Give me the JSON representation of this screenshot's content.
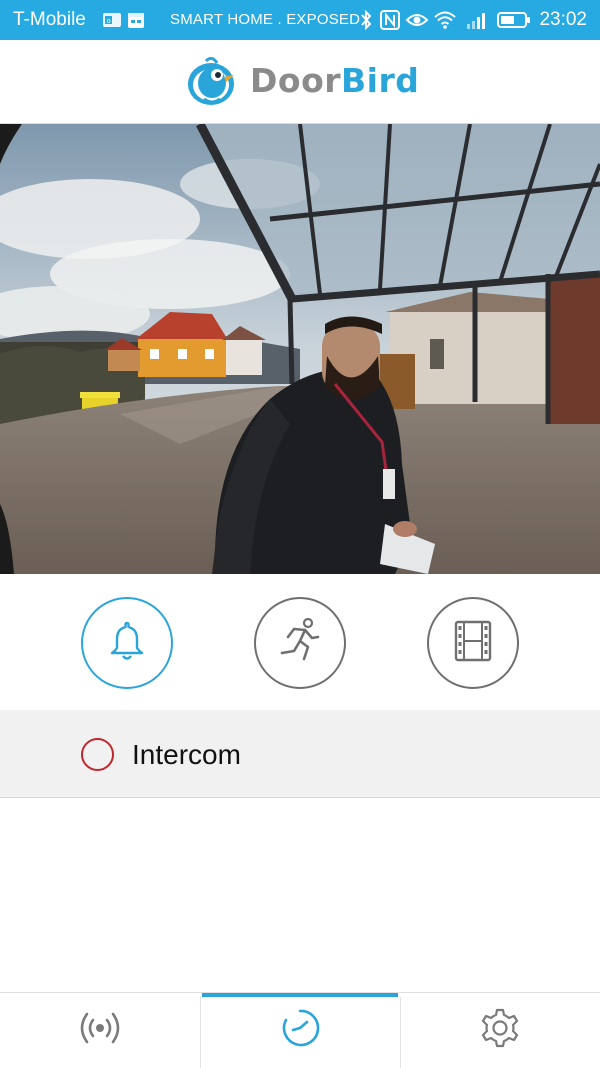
{
  "status_bar": {
    "carrier": "T-Mobile",
    "banner": "SMART HOME . EXPOSED",
    "time": "23:02",
    "icons": [
      "outlook-icon",
      "calendar-icon",
      "bluetooth-icon",
      "nfc-icon",
      "eye-icon",
      "wifi-icon",
      "signal-icon",
      "battery-icon"
    ]
  },
  "header": {
    "logo_word_1": "Door",
    "logo_word_2": "Bird"
  },
  "actions": [
    {
      "name": "doorbell",
      "icon": "bell-icon",
      "active": true
    },
    {
      "name": "motion",
      "icon": "running-person-icon",
      "active": false
    },
    {
      "name": "recordings",
      "icon": "film-icon",
      "active": false
    }
  ],
  "intercom": {
    "label": "Intercom",
    "status_color": "#c0272d"
  },
  "tabs": [
    {
      "name": "live",
      "icon": "broadcast-icon"
    },
    {
      "name": "history",
      "icon": "clock-icon",
      "active": true
    },
    {
      "name": "settings",
      "icon": "gear-icon"
    }
  ],
  "colors": {
    "accent": "#2aa5da",
    "status_bar": "#27a9e1",
    "icon_gray": "#6f6f6f"
  }
}
